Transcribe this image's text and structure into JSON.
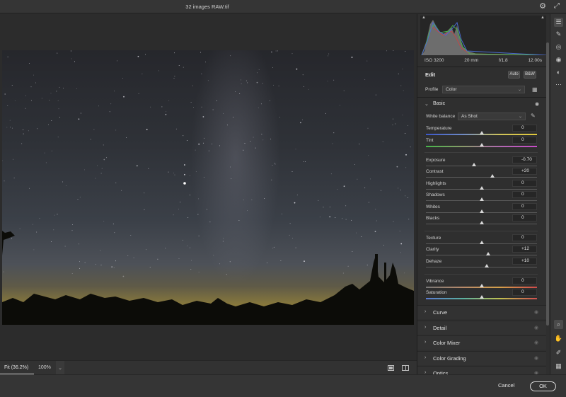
{
  "window": {
    "title": "32 images RAW.tif",
    "settings_icon": "gear-icon",
    "fullscreen_icon": "expand-icon"
  },
  "histogram": {
    "exif": {
      "iso": "ISO 3200",
      "focal": "20 mm",
      "aperture": "f/1.8",
      "shutter": "12.00s"
    },
    "colors": {
      "red": "#c04848",
      "green": "#48b048",
      "blue": "#4a6ad0",
      "luma": "#a8a8a8"
    }
  },
  "edit": {
    "title": "Edit",
    "auto_label": "Auto",
    "bw_label": "B&W",
    "profile_label": "Profile",
    "profile_value": "Color",
    "basic": {
      "label": "Basic",
      "white_balance_label": "White balance",
      "white_balance_value": "As Shot",
      "sliders": [
        {
          "key": "temperature",
          "label": "Temperature",
          "value": "0",
          "position": 0.5
        },
        {
          "key": "tint",
          "label": "Tint",
          "value": "0",
          "position": 0.5
        },
        {
          "key": "exposure",
          "label": "Exposure",
          "value": "-0.70",
          "position": 0.43
        },
        {
          "key": "contrast",
          "label": "Contrast",
          "value": "+20",
          "position": 0.6
        },
        {
          "key": "highlights",
          "label": "Highlights",
          "value": "0",
          "position": 0.5
        },
        {
          "key": "shadows",
          "label": "Shadows",
          "value": "0",
          "position": 0.5
        },
        {
          "key": "whites",
          "label": "Whites",
          "value": "0",
          "position": 0.5
        },
        {
          "key": "blacks",
          "label": "Blacks",
          "value": "0",
          "position": 0.5
        },
        {
          "key": "texture",
          "label": "Texture",
          "value": "0",
          "position": 0.5
        },
        {
          "key": "clarity",
          "label": "Clarity",
          "value": "+12",
          "position": 0.56
        },
        {
          "key": "dehaze",
          "label": "Dehaze",
          "value": "+10",
          "position": 0.55
        },
        {
          "key": "vibrance",
          "label": "Vibrance",
          "value": "0",
          "position": 0.5
        },
        {
          "key": "saturation",
          "label": "Saturation",
          "value": "0",
          "position": 0.5
        }
      ]
    },
    "sections": [
      "Curve",
      "Detail",
      "Color Mixer",
      "Color Grading",
      "Optics"
    ]
  },
  "view": {
    "fit_label": "Fit (36.2%)",
    "zoom_label": "100%"
  },
  "footer": {
    "cancel_label": "Cancel",
    "ok_label": "OK"
  },
  "tools": [
    "edit-sliders-icon",
    "heal-brush-icon",
    "red-eye-icon",
    "presets-icon",
    "more-icon",
    "zoom-icon",
    "hand-icon",
    "sampler-icon",
    "grid-icon"
  ]
}
